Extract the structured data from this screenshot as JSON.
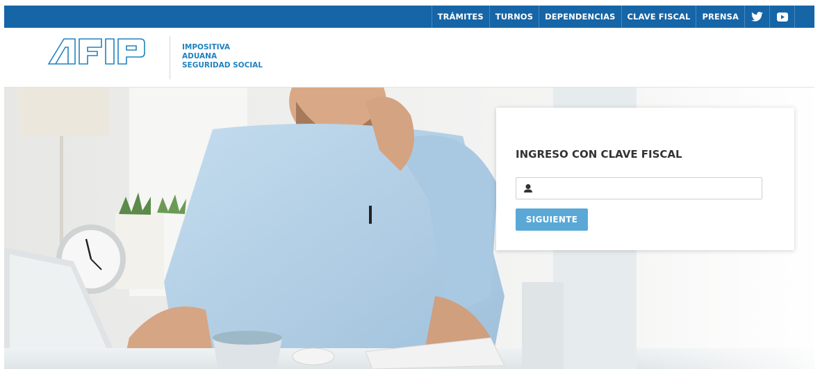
{
  "nav": {
    "items": [
      {
        "label": "TRÁMITES"
      },
      {
        "label": "TURNOS"
      },
      {
        "label": "DEPENDENCIAS"
      },
      {
        "label": "CLAVE FISCAL"
      },
      {
        "label": "PRENSA"
      }
    ],
    "social": [
      {
        "icon": "twitter-icon"
      },
      {
        "icon": "youtube-icon"
      }
    ]
  },
  "header": {
    "logo_text": "AFIP",
    "tagline": [
      "IMPOSITIVA",
      "ADUANA",
      "SEGURIDAD SOCIAL"
    ]
  },
  "login": {
    "title": "INGRESO CON CLAVE FISCAL",
    "user_icon": "user-icon",
    "cuit_value": "",
    "button_label": "SIGUIENTE"
  },
  "colors": {
    "topbar": "#1565a7",
    "brand_blue": "#1f82c0",
    "button": "#5aa8d6"
  }
}
